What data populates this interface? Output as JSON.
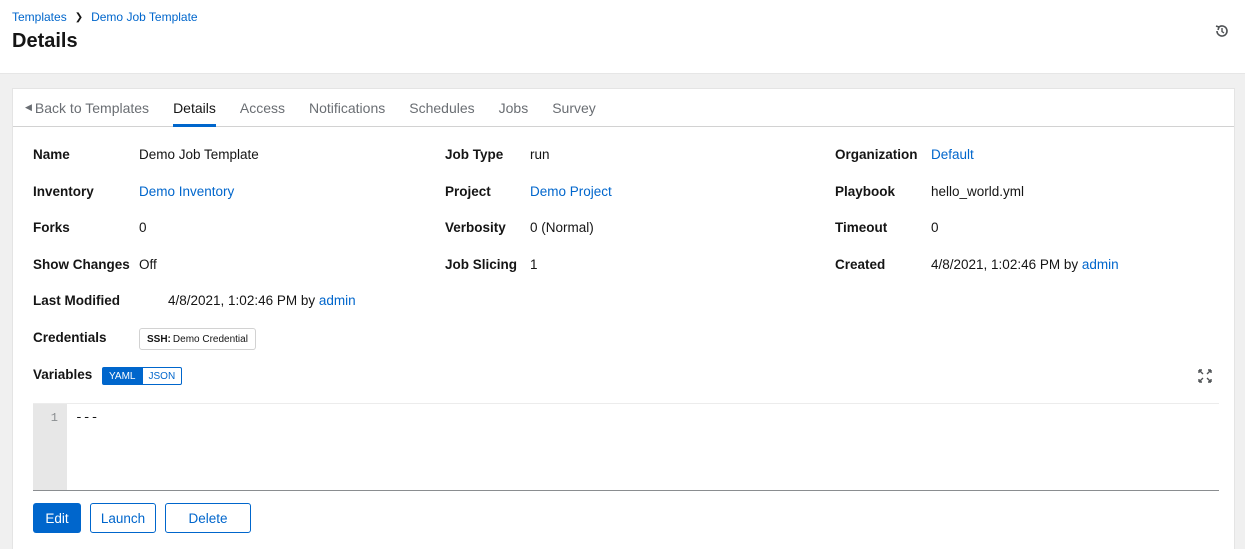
{
  "breadcrumb": {
    "parent": "Templates",
    "current": "Demo Job Template"
  },
  "page": {
    "title": "Details"
  },
  "tabs": [
    {
      "label": "Back to Templates"
    },
    {
      "label": "Details"
    },
    {
      "label": "Access"
    },
    {
      "label": "Notifications"
    },
    {
      "label": "Schedules"
    },
    {
      "label": "Jobs"
    },
    {
      "label": "Survey"
    }
  ],
  "details": {
    "name": {
      "label": "Name",
      "value": "Demo Job Template"
    },
    "job_type": {
      "label": "Job Type",
      "value": "run"
    },
    "organization": {
      "label": "Organization",
      "value": "Default"
    },
    "inventory": {
      "label": "Inventory",
      "value": "Demo Inventory"
    },
    "project": {
      "label": "Project",
      "value": "Demo Project"
    },
    "playbook": {
      "label": "Playbook",
      "value": "hello_world.yml"
    },
    "forks": {
      "label": "Forks",
      "value": "0"
    },
    "verbosity": {
      "label": "Verbosity",
      "value": "0 (Normal)"
    },
    "timeout": {
      "label": "Timeout",
      "value": "0"
    },
    "show_changes": {
      "label": "Show Changes",
      "value": "Off"
    },
    "job_slicing": {
      "label": "Job Slicing",
      "value": "1"
    },
    "created": {
      "label": "Created",
      "date": "4/8/2021, 1:02:46 PM",
      "by": "by",
      "user": "admin"
    },
    "last_modified": {
      "label": "Last Modified",
      "date": "4/8/2021, 1:02:46 PM",
      "by": "by",
      "user": "admin"
    },
    "credentials": {
      "label": "Credentials",
      "type": "SSH:",
      "name": "Demo Credential"
    }
  },
  "variables": {
    "label": "Variables",
    "yaml_label": "YAML",
    "json_label": "JSON",
    "line_number": "1",
    "content": "---"
  },
  "actions": {
    "edit": "Edit",
    "launch": "Launch",
    "delete": "Delete"
  },
  "colors": {
    "accent": "#0066cc",
    "text": "#151515",
    "muted": "#6a6e73"
  }
}
